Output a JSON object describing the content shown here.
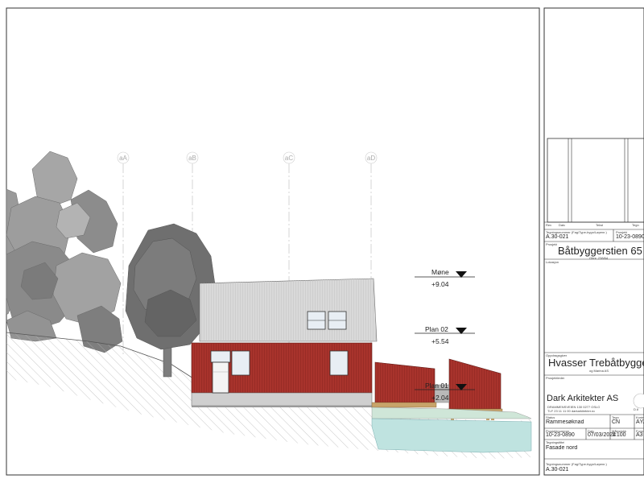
{
  "grid_axes": [
    "aA",
    "aB",
    "aC",
    "aD"
  ],
  "levels": [
    {
      "name": "Møne",
      "elevation": "+9.04"
    },
    {
      "name": "Plan 02",
      "elevation": "+5.54"
    },
    {
      "name": "Plan 01",
      "elevation": "+2.04"
    }
  ],
  "colors": {
    "facade_red": "#a8332c",
    "roof_grey": "#d6d6d6",
    "water": "#bfe3e0",
    "tree_grey": "#8f8f8f"
  },
  "title_block": {
    "revision_headers": {
      "rev": "Rev",
      "date": "Dato",
      "description": "Tekst",
      "drawn": "Tegn"
    },
    "drawing_no_caption": "Tegningsnummer (Fag/Type-bygn/Løpenr.)",
    "drawing_no": "A.30-021",
    "project_no_caption": "Prosjekt",
    "project_no": "10-23-0890",
    "project_caption": "Prosjekt",
    "project_name": "Båtbyggerstien 65",
    "project_sub": "Gbnr. 238/64",
    "location_caption": "Lokasjon",
    "client_caption": "Oppdragsgiver",
    "client_name": "Hvasser Trebåtbyggeri",
    "client_sub": "og Marina AS",
    "project_manager_caption": "Prosjektleder",
    "architect_name": "Dark Arkitekter AS",
    "architect_address": "DRAMMENSVEIEN 130    0277 OSLO",
    "architect_contact": "TLF 23 11 11 00    darkarkitekter.no",
    "architect_logo_text": "D A",
    "status_caption": "Status",
    "status": "Rammesøknad",
    "drawn_caption": "Tegn",
    "drawn_by": "CN",
    "checked_caption": "Kontr.",
    "checked_by": "ÅYA",
    "project_no2_caption": "Prosjektnummer",
    "project_no2": "10-23-0890",
    "date_caption": "Dato",
    "date": "07/03/2024",
    "scale_caption": "Målestokk",
    "scale": "1:100",
    "format_caption": "Format",
    "format": "A3",
    "drawing_title_caption": "Tegningstittel",
    "drawing_title": "Fasade nord",
    "drawing_no_footer": "A.30-021"
  }
}
